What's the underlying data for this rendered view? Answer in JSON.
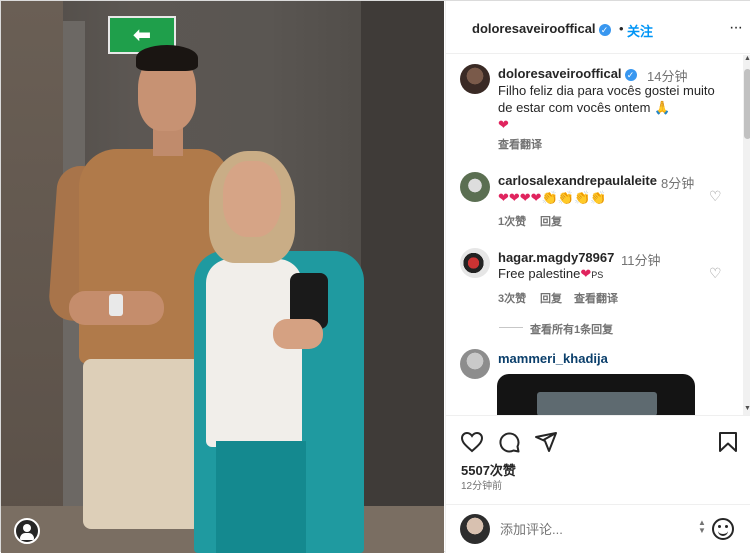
{
  "photo": {
    "exit_sign_glyph": "⬅",
    "accent_colors": {
      "coat": "#1f9aa0",
      "shirt": "#b07a4a",
      "exit_sign": "#1f9f4b"
    }
  },
  "header": {
    "username": "doloresaveirooffical",
    "verified_glyph": "✓",
    "separator": "•",
    "follow_label": "关注",
    "more_icon": "···"
  },
  "caption": {
    "username": "doloresaveirooffical",
    "time": "14分钟",
    "text": "Filho feliz dia para vocês gostei muito de estar com vocês ontem 🙏",
    "heart": "❤",
    "translate": "查看翻译"
  },
  "comments": [
    {
      "username": "carlosalexandrepaulaleite",
      "time": "8分钟",
      "text": "❤❤❤❤👏👏👏👏",
      "likes": "1次赞",
      "reply": "回复"
    },
    {
      "username": "hagar.magdy78967",
      "time": "11分钟",
      "text": "Free palestine",
      "heart": "❤",
      "suffix": "PS",
      "likes": "3次赞",
      "reply": "回复",
      "translate": "查看翻译"
    }
  ],
  "view_replies": "查看所有1条回复",
  "next_comment": {
    "username": "mammeri_khadija"
  },
  "actions": {
    "like_icon": "heart-icon",
    "comment_icon": "comment-icon",
    "share_icon": "share-icon",
    "save_icon": "bookmark-icon",
    "likes": "5507次赞",
    "ago": "12分钟前"
  },
  "add_comment": {
    "placeholder": "添加评论..."
  }
}
